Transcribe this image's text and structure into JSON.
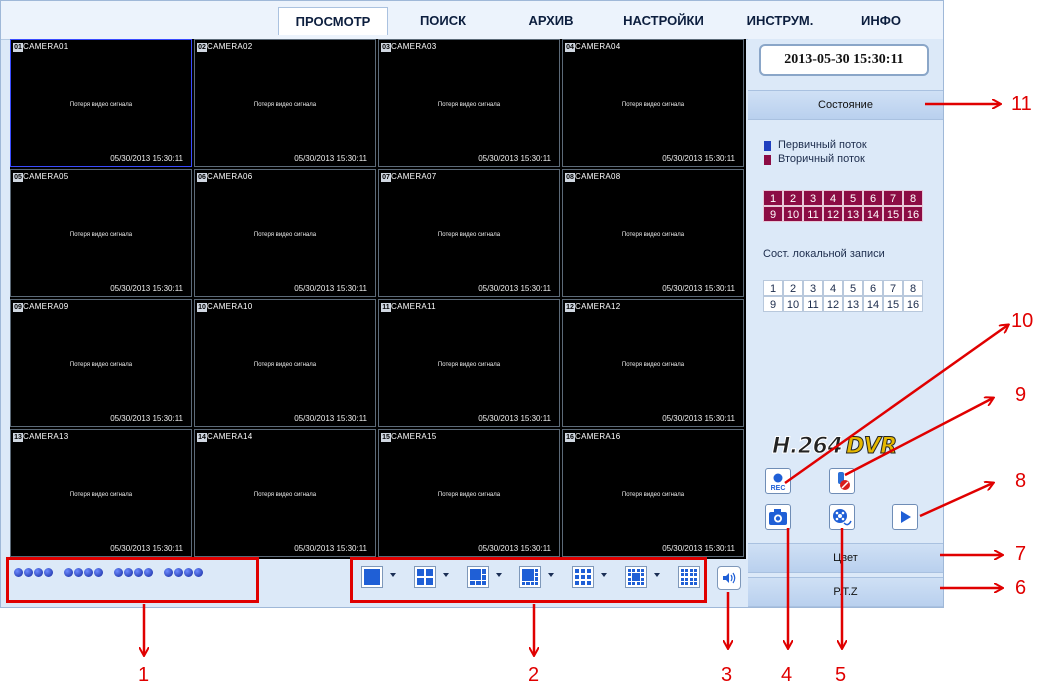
{
  "menu": {
    "items": [
      "ПРОСМОТР",
      "ПОИСК",
      "АРХИВ",
      "НАСТРОЙКИ",
      "ИНСТРУМ.",
      "ИНФО"
    ],
    "active": "ПРОСМОТР"
  },
  "cameras": [
    {
      "num": "01",
      "name": "CAMERA01",
      "msg": "Потеря видео сигнала",
      "time": "05/30/2013 15:30:11"
    },
    {
      "num": "02",
      "name": "CAMERA02",
      "msg": "Потеря видео сигнала",
      "time": "05/30/2013 15:30:11"
    },
    {
      "num": "03",
      "name": "CAMERA03",
      "msg": "Потеря видео сигнала",
      "time": "05/30/2013 15:30:11"
    },
    {
      "num": "04",
      "name": "CAMERA04",
      "msg": "Потеря видео сигнала",
      "time": "05/30/2013 15:30:11"
    },
    {
      "num": "05",
      "name": "CAMERA05",
      "msg": "Потеря видео сигнала",
      "time": "05/30/2013 15:30:11"
    },
    {
      "num": "06",
      "name": "CAMERA06",
      "msg": "Потеря видео сигнала",
      "time": "05/30/2013 15:30:11"
    },
    {
      "num": "07",
      "name": "CAMERA07",
      "msg": "Потеря видео сигнала",
      "time": "05/30/2013 15:30:11"
    },
    {
      "num": "08",
      "name": "CAMERA08",
      "msg": "Потеря видео сигнала",
      "time": "05/30/2013 15:30:11"
    },
    {
      "num": "09",
      "name": "CAMERA09",
      "msg": "Потеря видео сигнала",
      "time": "05/30/2013 15:30:11"
    },
    {
      "num": "10",
      "name": "CAMERA10",
      "msg": "Потеря видео сигнала",
      "time": "05/30/2013 15:30:11"
    },
    {
      "num": "11",
      "name": "CAMERA11",
      "msg": "Потеря видео сигнала",
      "time": "05/30/2013 15:30:11"
    },
    {
      "num": "12",
      "name": "CAMERA12",
      "msg": "Потеря видео сигнала",
      "time": "05/30/2013 15:30:11"
    },
    {
      "num": "13",
      "name": "CAMERA13",
      "msg": "Потеря видео сигнала",
      "time": "05/30/2013 15:30:11"
    },
    {
      "num": "14",
      "name": "CAMERA14",
      "msg": "Потеря видео сигнала",
      "time": "05/30/2013 15:30:11"
    },
    {
      "num": "15",
      "name": "CAMERA15",
      "msg": "Потеря видео сигнала",
      "time": "05/30/2013 15:30:11"
    },
    {
      "num": "16",
      "name": "CAMERA16",
      "msg": "Потеря видео сигнала",
      "time": "05/30/2013 15:30:11"
    }
  ],
  "panel": {
    "datetime": "2013-05-30 15:30:11",
    "status_label": "Состояние",
    "legend": [
      {
        "label": "Первичный поток",
        "color": "#1f3fbf"
      },
      {
        "label": "Вторичный поток",
        "color": "#8c0c44"
      }
    ],
    "channels": [
      "1",
      "2",
      "3",
      "4",
      "5",
      "6",
      "7",
      "8",
      "9",
      "10",
      "11",
      "12",
      "13",
      "14",
      "15",
      "16"
    ],
    "local_record_label": "Сост. локальной записи",
    "logo": "H.264 DVR",
    "color_label": "Цвет",
    "ptz_label": "P.T.Z"
  },
  "colors": {
    "accent": "#e00000",
    "stream_channel": "#8c0c44",
    "indicator_blue": "#1f3fbf"
  },
  "icons": [
    "rec-icon",
    "manual-alarm-icon",
    "snapshot-icon",
    "playback-icon",
    "play-icon",
    "speaker-icon"
  ],
  "annotations": [
    "1",
    "2",
    "3",
    "4",
    "5",
    "6",
    "7",
    "8",
    "9",
    "10",
    "11"
  ]
}
